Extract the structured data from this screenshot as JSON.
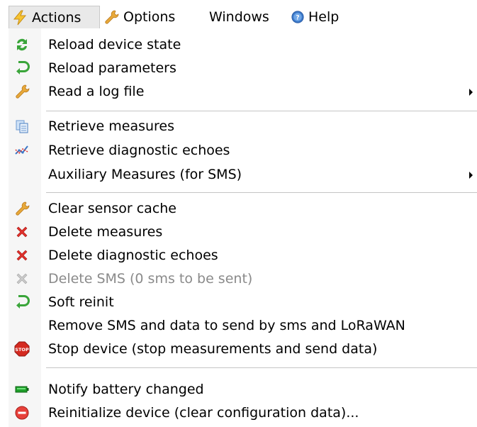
{
  "menubar": {
    "actions": "Actions",
    "options": "Options",
    "windows": "Windows",
    "help": "Help"
  },
  "menu": {
    "group1": {
      "reload_device_state": "Reload device state",
      "reload_parameters": "Reload parameters",
      "read_log_file": "Read a log file"
    },
    "group2": {
      "retrieve_measures": "Retrieve measures",
      "retrieve_diagnostic_echoes": "Retrieve diagnostic echoes",
      "auxiliary_measures": "Auxiliary Measures (for SMS)"
    },
    "group3": {
      "clear_sensor_cache": "Clear sensor cache",
      "delete_measures": "Delete measures",
      "delete_diagnostic_echoes": "Delete diagnostic echoes",
      "delete_sms": "Delete SMS (0 sms to be sent)",
      "soft_reinit": "Soft reinit",
      "remove_sms_data": "Remove SMS and data to send by sms and LoRaWAN",
      "stop_device": "Stop device (stop measurements and send data)"
    },
    "group4": {
      "notify_battery": "Notify battery changed",
      "reinitialize_device": "Reinitialize device (clear configuration  data)..."
    }
  },
  "icons": {
    "stop_text": "STOP"
  },
  "colors": {
    "lightning": "#f7c431",
    "refresh_green": "#3aa53a",
    "wrench": "#e8a93a",
    "delete_red": "#e0302b",
    "disabled_gray": "#8a8a8a",
    "help_blue": "#3b78c8"
  }
}
